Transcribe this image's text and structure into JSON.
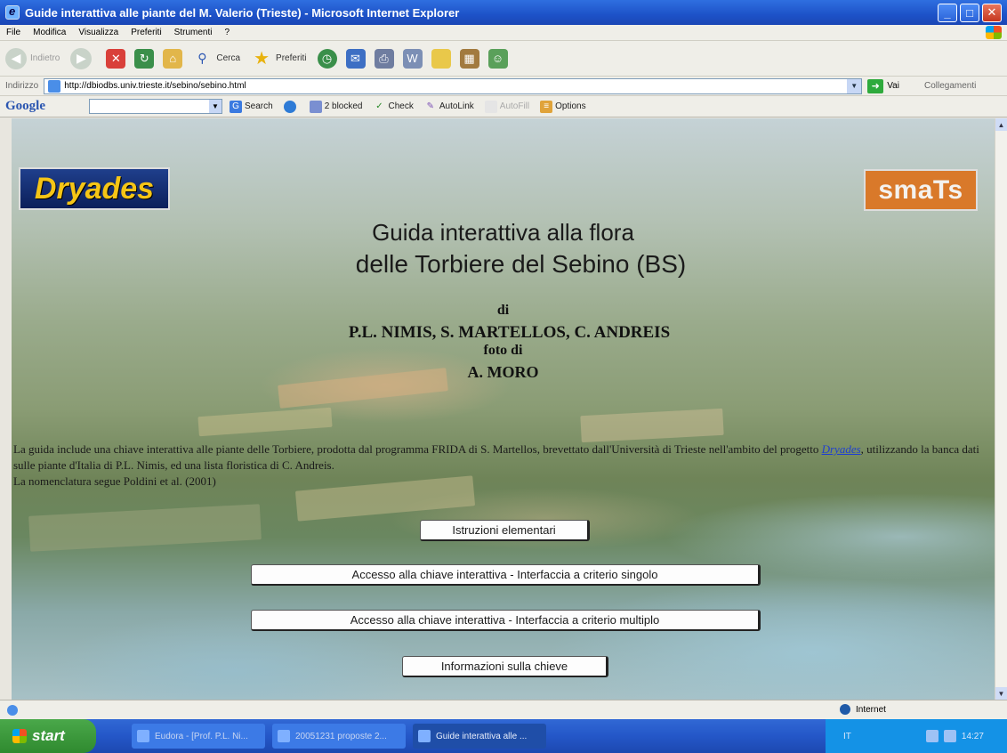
{
  "window": {
    "title": "Guide interattiva alle piante del M. Valerio (Trieste) - Microsoft Internet Explorer",
    "minimize": "_",
    "maximize": "□",
    "close": "✕"
  },
  "menu": [
    "File",
    "Modifica",
    "Visualizza",
    "Preferiti",
    "Strumenti",
    "?"
  ],
  "toolbar": {
    "back": "Indietro",
    "search": "Cerca",
    "favorites": "Preferiti"
  },
  "addressbar": {
    "label": "Indirizzo",
    "url": "http://dbiodbs.univ.trieste.it/sebino/sebino.html",
    "go": "Vai",
    "links": "Collegamenti"
  },
  "googlebar": {
    "logo": "Google",
    "search": "Search",
    "blocked": "2 blocked",
    "check": "Check",
    "autolink": "AutoLink",
    "autofill": "AutoFill",
    "options": "Options"
  },
  "page": {
    "logo_left": "Dryades",
    "logo_right": "smaTs",
    "title_line1": "Guida interattiva alla flora",
    "title_line2": "delle Torbiere del Sebino (BS)",
    "di": "di",
    "authors": "P.L. NIMIS, S. MARTELLOS, C. ANDREIS",
    "foto_di": "foto di",
    "photographer": "A. MORO",
    "para_part1": "La guida include una chiave interattiva alle piante delle Torbiere, prodotta dal programma FRIDA di S. Martellos, brevettato dall'Università di Trieste nell'ambito del progetto ",
    "para_link": "Dryades",
    "para_part2": ", utilizzando la banca dati sulle piante d'Italia di P.L. Nimis, ed una lista floristica di C. Andreis.",
    "para_line2": "La nomenclatura segue Poldini et al. (2001)",
    "buttons": {
      "instructions": "Istruzioni elementari",
      "single": "Accesso alla chiave interattiva - Interfaccia a criterio singolo",
      "multiple": "Accesso alla chiave interattiva - Interfaccia a criterio multiplo",
      "info": "Informazioni sulla chieve"
    }
  },
  "statusbar": {
    "zone": "Internet"
  },
  "taskbar": {
    "start": "start",
    "tasks": [
      "Eudora - [Prof. P.L. Ni...",
      "20051231 proposte 2...",
      "Guide interattiva alle ..."
    ],
    "lang": "IT",
    "clock": "14:27"
  }
}
